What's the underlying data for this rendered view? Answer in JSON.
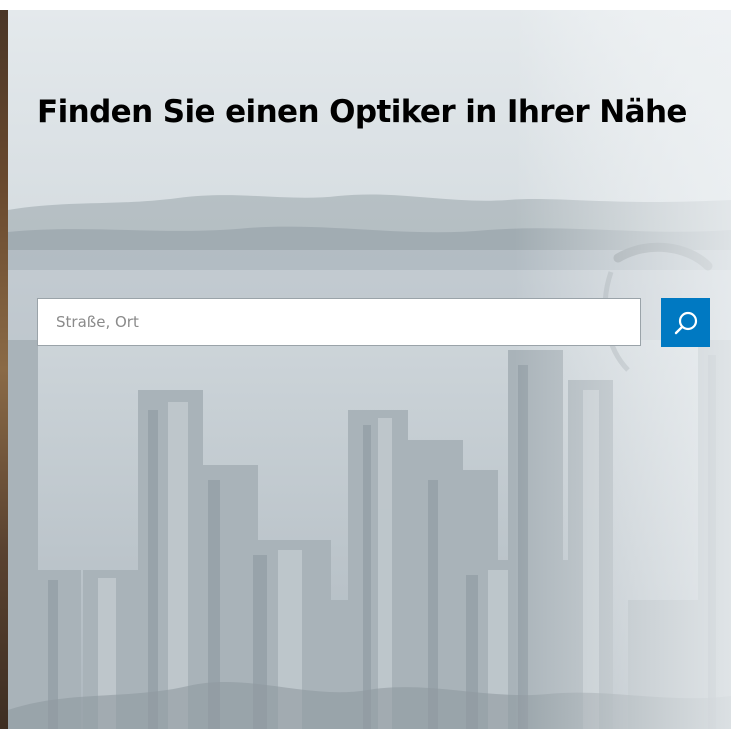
{
  "hero": {
    "title": "Finden Sie einen Optiker in Ihrer Nähe"
  },
  "search": {
    "placeholder": "Straße, Ort",
    "value": "",
    "button_icon": "search-icon"
  },
  "colors": {
    "accent": "#0079c2",
    "title_text": "#000000",
    "input_border": "#9aa3a9",
    "background_haze": "#dde3e7"
  }
}
